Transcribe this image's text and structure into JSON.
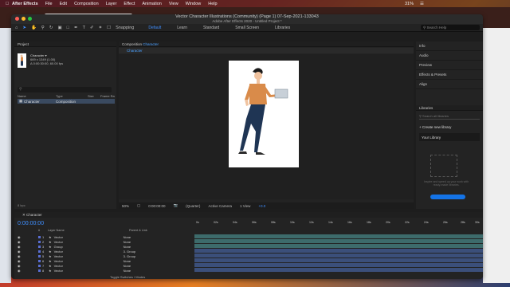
{
  "menubar": {
    "app": "After Effects",
    "items": [
      "File",
      "Edit",
      "Composition",
      "Layer",
      "Effect",
      "Animation",
      "View",
      "Window",
      "Help"
    ],
    "battery": "31%",
    "apple_icon": "apple-icon"
  },
  "browser": {
    "tab_title": "Vector Character Illustrations (Com…",
    "tab_text": [
      "Design",
      "Prototype",
      "Share"
    ]
  },
  "window": {
    "title": "Vector Character Illustrations (Community) (Page 1) 07-Sep-2021-133043",
    "subtitle": "Adobe After Effects 2020 - Untitled Project *"
  },
  "toolbar": {
    "snapping": "Snapping",
    "workspaces": [
      "Default",
      "Learn",
      "Standard",
      "Small Screen",
      "Libraries"
    ],
    "active_workspace": "Default",
    "search_placeholder": "Search Help"
  },
  "project": {
    "panel_title": "Project",
    "item_name": "Character ▾",
    "item_dims": "669 x 1349 (1.00)",
    "item_duration": "Δ 0:00:30:00, 60.00 fps",
    "columns": [
      "Name",
      "Type",
      "Size",
      "Frame Ra"
    ],
    "row_name": "Character",
    "row_type": "Composition",
    "footer": "8 bpc"
  },
  "composition": {
    "panel_title": "Composition",
    "comp_name": "Character",
    "tab_label": "Character",
    "zoom": "50%",
    "timecode": "0:00:00:00",
    "resolution": "(Quarter)",
    "camera": "Active Camera",
    "view": "1 View",
    "exposure": "+0.0"
  },
  "right_panels": {
    "items": [
      "Info",
      "Audio",
      "Preview",
      "Effects & Presets",
      "Align"
    ],
    "libraries_title": "Libraries",
    "search_placeholder": "Search all libraries",
    "create_new": "+ Create new library",
    "your_library": "Your Library",
    "empty_text": "Inspire and speed up your work with ready-made libraries."
  },
  "timeline": {
    "tab_title": "Character",
    "timecode": "0:00:00:00",
    "columns": [
      "#",
      "Layer Name",
      "Parent & Link"
    ],
    "ruler": [
      "0s",
      "02s",
      "04s",
      "06s",
      "08s",
      "10s",
      "12s",
      "14s",
      "16s",
      "18s",
      "20s",
      "22s",
      "24s",
      "26s",
      "28s",
      "30s"
    ],
    "layers": [
      {
        "num": "1",
        "name": "Vector",
        "parent": "None",
        "color": "#5a6fd6"
      },
      {
        "num": "2",
        "name": "Vector",
        "parent": "None",
        "color": "#5a6fd6"
      },
      {
        "num": "3",
        "name": "Group",
        "parent": "None",
        "color": "#5a6fd6"
      },
      {
        "num": "4",
        "name": "Vector",
        "parent": "3. Group",
        "color": "#5a6fd6"
      },
      {
        "num": "5",
        "name": "Vector",
        "parent": "3. Group",
        "color": "#5a6fd6"
      },
      {
        "num": "6",
        "name": "Vector",
        "parent": "None",
        "color": "#5a6fd6"
      },
      {
        "num": "7",
        "name": "Vector",
        "parent": "None",
        "color": "#5a6fd6"
      },
      {
        "num": "8",
        "name": "Vector",
        "parent": "None",
        "color": "#5a6fd6"
      }
    ],
    "footer": "Toggle Switches / Modes"
  },
  "colors": {
    "accent": "#3f8fff",
    "track_teal": "#3d6b6b",
    "track_blue": "#3b4f7a",
    "shirt": "#d98b4a",
    "pants": "#1f3554"
  }
}
